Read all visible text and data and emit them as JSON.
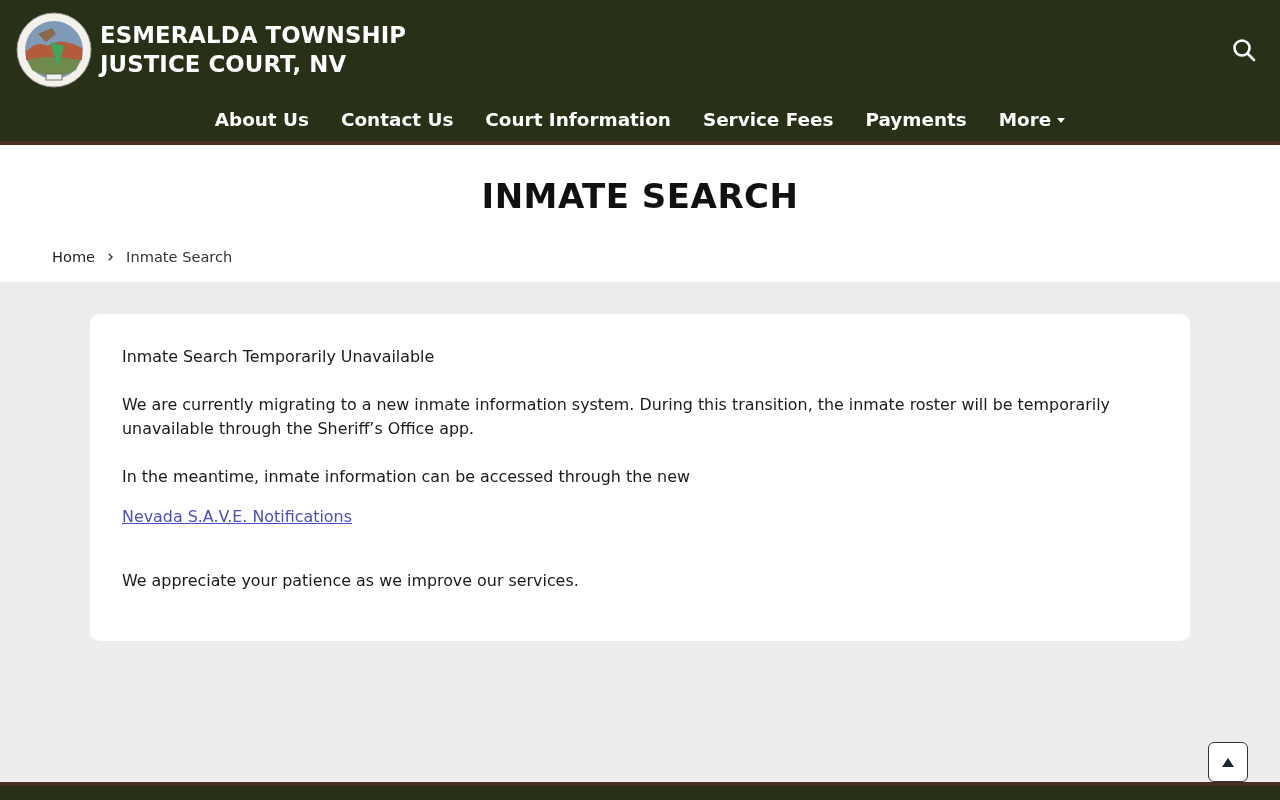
{
  "header": {
    "title_lines": [
      "ESMERALDA TOWNSHIP",
      "JUSTICE COURT, NV"
    ]
  },
  "nav": {
    "items": [
      {
        "label": "About Us",
        "has_dropdown": false
      },
      {
        "label": "Contact Us",
        "has_dropdown": false
      },
      {
        "label": "Court Information",
        "has_dropdown": false
      },
      {
        "label": "Service Fees",
        "has_dropdown": false
      },
      {
        "label": "Payments",
        "has_dropdown": false
      },
      {
        "label": "More",
        "has_dropdown": true
      }
    ]
  },
  "page_title": "INMATE SEARCH",
  "breadcrumb": [
    {
      "label": "Home",
      "kind": "link"
    },
    {
      "label": "Inmate Search",
      "kind": "current"
    }
  ],
  "notice": {
    "paragraphs": [
      {
        "kind": "text",
        "text": "Inmate Search Temporarily Unavailable"
      },
      {
        "kind": "text",
        "text": "We are currently migrating to a new inmate information system. During this transition, the inmate roster will be temporarily unavailable through the Sheriff’s Office app."
      },
      {
        "kind": "text",
        "text": "In the meantime, inmate information can be accessed through the new"
      },
      {
        "kind": "link",
        "text": "Nevada S.A.V.E. Notifications"
      },
      {
        "kind": "text",
        "text": "We appreciate your patience as we improve our services."
      }
    ]
  }
}
